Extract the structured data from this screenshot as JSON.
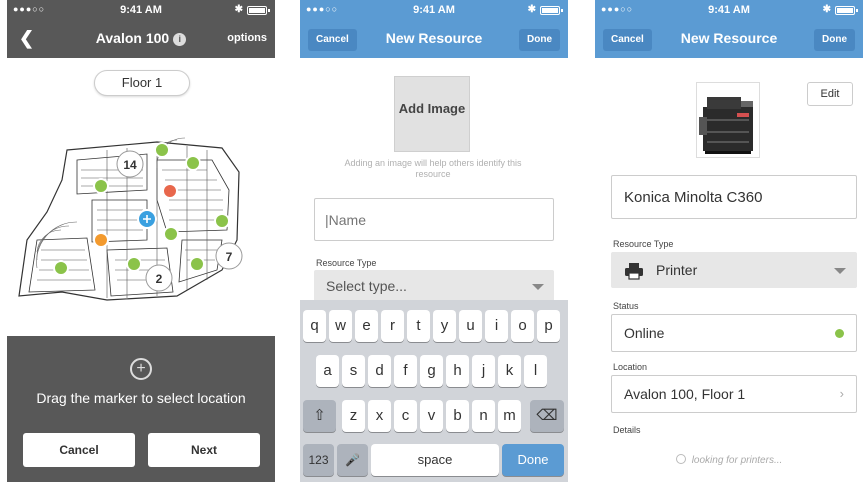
{
  "status_bar": {
    "signal": "●●●○○",
    "time": "9:41 AM",
    "bluetooth": "✱"
  },
  "screen1": {
    "title": "Avalon 100",
    "info_icon": "i",
    "options_label": "options",
    "floor_label": "Floor 1",
    "cluster_counts": [
      "14",
      "2",
      "7"
    ],
    "instruction": "Drag the marker to select location",
    "cancel_label": "Cancel",
    "next_label": "Next",
    "marker_colors": {
      "green": "#8bc34a",
      "orange": "#f39a2e",
      "red": "#e8674c",
      "blue": "#3aa0e0"
    }
  },
  "screen2": {
    "cancel_label": "Cancel",
    "title": "New Resource",
    "done_label": "Done",
    "add_image_label": "Add Image",
    "image_hint": "Adding an image will help others identify this resource",
    "name_placeholder": "|Name",
    "resource_type_label": "Resource Type",
    "select_placeholder": "Select type...",
    "keyboard": {
      "row1": [
        "q",
        "w",
        "e",
        "r",
        "t",
        "y",
        "u",
        "i",
        "o",
        "p"
      ],
      "row2": [
        "a",
        "s",
        "d",
        "f",
        "g",
        "h",
        "j",
        "k",
        "l"
      ],
      "row3": [
        "z",
        "x",
        "c",
        "v",
        "b",
        "n",
        "m"
      ],
      "shift": "⇧",
      "backspace": "⌫",
      "numbers": "123",
      "mic": "🎤",
      "space": "space",
      "done": "Done"
    }
  },
  "screen3": {
    "cancel_label": "Cancel",
    "title": "New Resource",
    "done_label": "Done",
    "edit_label": "Edit",
    "name_value": "Konica Minolta C360",
    "resource_type_label": "Resource Type",
    "resource_type_value": "Printer",
    "status_label": "Status",
    "status_value": "Online",
    "location_label": "Location",
    "location_value": "Avalon 100, Floor 1",
    "details_label": "Details",
    "loading_text": "looking for printers...",
    "status_color": "#8bc34a"
  },
  "accent_blue": "#5b9bd3",
  "dark_gray": "#585858"
}
